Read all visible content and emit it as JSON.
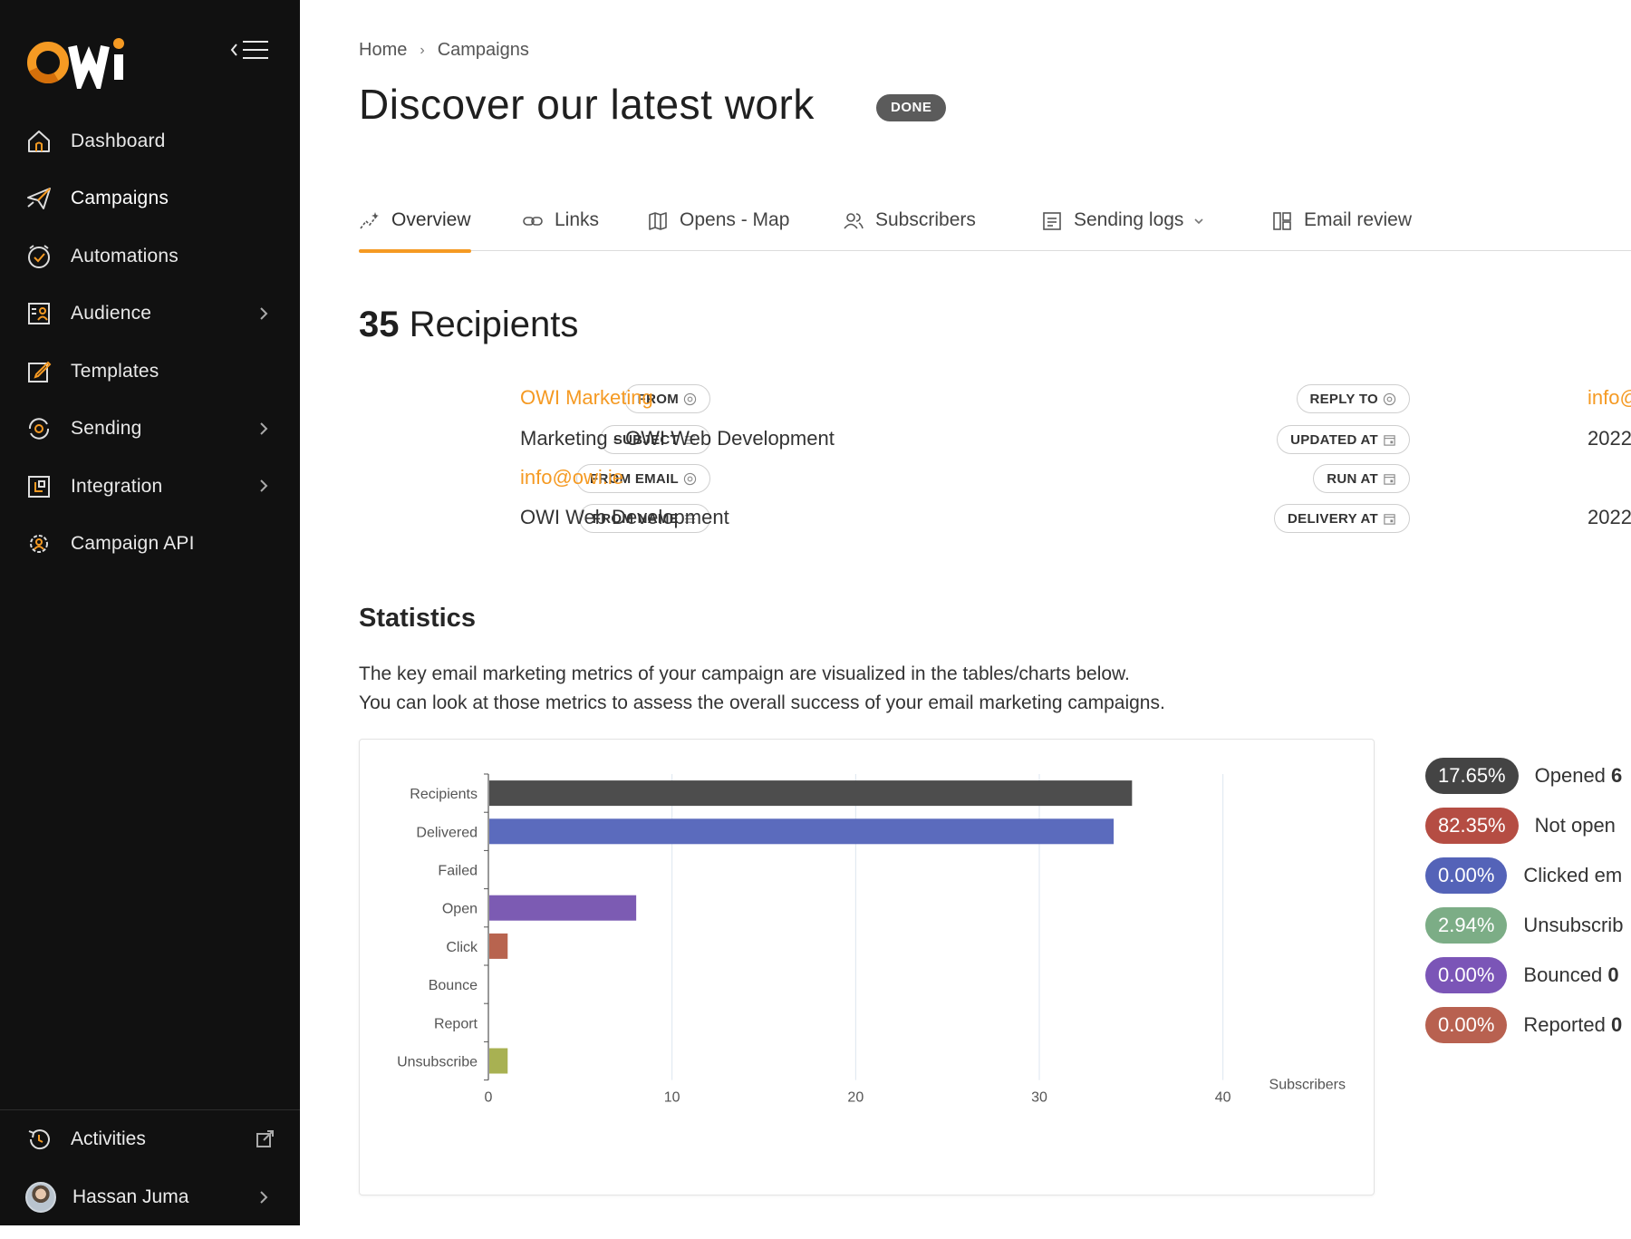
{
  "brand": {
    "logo_text": "OWI",
    "accent": "#f59a23"
  },
  "sidebar": {
    "items": [
      {
        "label": "Dashboard",
        "icon": "home-icon",
        "has_children": false
      },
      {
        "label": "Campaigns",
        "icon": "paper-plane-icon",
        "has_children": false,
        "active": true
      },
      {
        "label": "Automations",
        "icon": "clock-check-icon",
        "has_children": false
      },
      {
        "label": "Audience",
        "icon": "contacts-icon",
        "has_children": true
      },
      {
        "label": "Templates",
        "icon": "edit-square-icon",
        "has_children": false
      },
      {
        "label": "Sending",
        "icon": "sync-target-icon",
        "has_children": true
      },
      {
        "label": "Integration",
        "icon": "plug-square-icon",
        "has_children": true
      },
      {
        "label": "Campaign API",
        "icon": "gear-user-icon",
        "has_children": false
      }
    ],
    "bottom": {
      "activities_label": "Activities",
      "user_name": "Hassan Juma"
    }
  },
  "breadcrumb": {
    "home": "Home",
    "current": "Campaigns"
  },
  "page": {
    "title": "Discover our latest work",
    "status": "DONE"
  },
  "tabs": [
    {
      "label": "Overview",
      "icon": "chart-sparkle-icon",
      "active": true
    },
    {
      "label": "Links",
      "icon": "link-icon"
    },
    {
      "label": "Opens - Map",
      "icon": "map-icon"
    },
    {
      "label": "Subscribers",
      "icon": "users-icon"
    },
    {
      "label": "Sending logs",
      "icon": "list-document-icon",
      "has_dropdown": true
    },
    {
      "label": "Email review",
      "icon": "layout-icon"
    }
  ],
  "recipients": {
    "count": "35",
    "label": "Recipients"
  },
  "meta_left": [
    {
      "tag": "FROM",
      "icon": "at-icon",
      "value": "OWI Marketing",
      "is_link": true
    },
    {
      "tag": "SUBJECT",
      "icon": "lines-icon",
      "value": "Marketing - OWI Web Development",
      "is_link": false
    },
    {
      "tag": "FROM EMAIL",
      "icon": "at-icon",
      "value": "info@owi.ie",
      "is_link": true
    },
    {
      "tag": "FROM NAME",
      "icon": "lines-icon",
      "value": "OWI Web Development",
      "is_link": false
    }
  ],
  "meta_right": [
    {
      "tag": "REPLY TO",
      "icon": "at-icon",
      "value": "info@",
      "is_link": true
    },
    {
      "tag": "UPDATED AT",
      "icon": "calendar-icon",
      "value": "2022",
      "is_link": false
    },
    {
      "tag": "RUN AT",
      "icon": "calendar-icon",
      "value": "",
      "is_link": false
    },
    {
      "tag": "DELIVERY AT",
      "icon": "calendar-icon",
      "value": "2022",
      "is_link": false
    }
  ],
  "statistics": {
    "title": "Statistics",
    "desc_line1": "The key email marketing metrics of your campaign are visualized in the tables/charts below.",
    "desc_line2": "You can look at those metrics to assess the overall success of your email marketing campaigns."
  },
  "chart_data": {
    "type": "bar",
    "orientation": "horizontal",
    "categories": [
      "Recipients",
      "Delivered",
      "Failed",
      "Open",
      "Click",
      "Bounce",
      "Report",
      "Unsubscribe"
    ],
    "values": [
      35,
      34,
      0,
      8,
      1,
      0,
      0,
      1
    ],
    "colors": [
      "#4d4d4d",
      "#5b6bbd",
      "#888888",
      "#7c5bb3",
      "#b8644f",
      "#888888",
      "#888888",
      "#a8b152"
    ],
    "xlabel": "Subscribers",
    "xlim": [
      0,
      45
    ],
    "xticks": [
      0,
      10,
      20,
      30,
      40
    ],
    "grid": true
  },
  "percentages": [
    {
      "value": "17.65%",
      "label": "Opened",
      "count": "6",
      "color": "#444444"
    },
    {
      "value": "82.35%",
      "label": "Not open",
      "count": "",
      "color": "#b54d43"
    },
    {
      "value": "0.00%",
      "label": "Clicked em",
      "count": "",
      "color": "#5463b8"
    },
    {
      "value": "2.94%",
      "label": "Unsubscrib",
      "count": "",
      "color": "#7cad86"
    },
    {
      "value": "0.00%",
      "label": "Bounced",
      "count": "0",
      "color": "#7b55b7"
    },
    {
      "value": "0.00%",
      "label": "Reported",
      "count": "0",
      "color": "#b86150"
    }
  ]
}
